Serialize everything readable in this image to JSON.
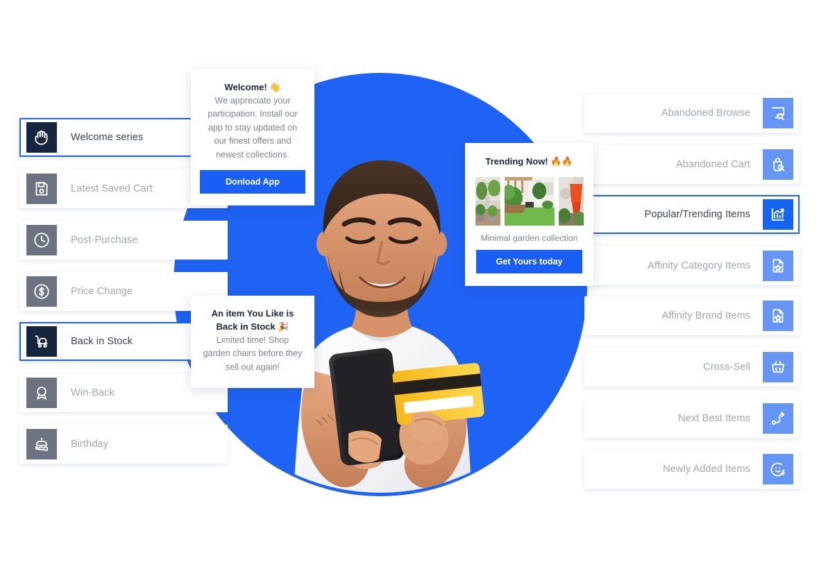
{
  "left_panel": {
    "items": [
      {
        "label": "Welcome series",
        "icon": "hand-wave-icon",
        "active": true
      },
      {
        "label": "Latest Saved Cart",
        "icon": "floppy-save-icon",
        "active": false
      },
      {
        "label": "Post-Purchase",
        "icon": "clock-icon",
        "active": false
      },
      {
        "label": "Price Change",
        "icon": "dollar-circle-icon",
        "active": false
      },
      {
        "label": "Back in Stock",
        "icon": "stock-cart-icon",
        "active": true
      },
      {
        "label": "Win-Back",
        "icon": "award-badge-icon",
        "active": false
      },
      {
        "label": "Birthday",
        "icon": "birthday-cake-icon",
        "active": false
      }
    ]
  },
  "right_panel": {
    "items": [
      {
        "label": "Abandoned Browse",
        "icon": "monitor-search-icon",
        "active": false
      },
      {
        "label": "Abandoned Cart",
        "icon": "bag-search-icon",
        "active": false
      },
      {
        "label": "Popular/Trending Items",
        "icon": "trending-chart-icon",
        "active": true
      },
      {
        "label": "Affinity Category Items",
        "icon": "document-star-icon",
        "active": false
      },
      {
        "label": "Affinity Brand Items",
        "icon": "document-star-icon",
        "active": false
      },
      {
        "label": "Cross-Sell",
        "icon": "basket-code-icon",
        "active": false
      },
      {
        "label": "Next Best Items",
        "icon": "path-arrow-icon",
        "active": false
      },
      {
        "label": "Newly Added Items",
        "icon": "smiley-plus-icon",
        "active": false
      }
    ]
  },
  "cards": {
    "welcome": {
      "title": "Welcome! 👋",
      "body": "We appreciate your participation. Install our app to stay updated on our finest offers and newest collections.",
      "cta": "Donload App"
    },
    "trending": {
      "title": "Trending Now! 🔥🔥",
      "caption": "Minimal garden collection",
      "cta": "Get Yours today",
      "thumbnails": [
        "garden-plants-patio",
        "garden-lawn-pergola",
        "orange-chair"
      ]
    },
    "back_in_stock": {
      "title_line1": "An item You Like is",
      "title_line2": "Back in Stock 🎉",
      "body": "Limited time! Shop garden chairs before they sell out again!"
    }
  },
  "colors": {
    "brand_blue": "#1f63f5",
    "cta_blue": "#1a5ff5",
    "icon_blue_light": "#6696f5",
    "icon_blue_active": "#1565f5",
    "icon_gray": "#6b7280",
    "icon_navy": "#16263f",
    "label_muted": "#a0a6b0",
    "label_active": "#3a4150"
  }
}
